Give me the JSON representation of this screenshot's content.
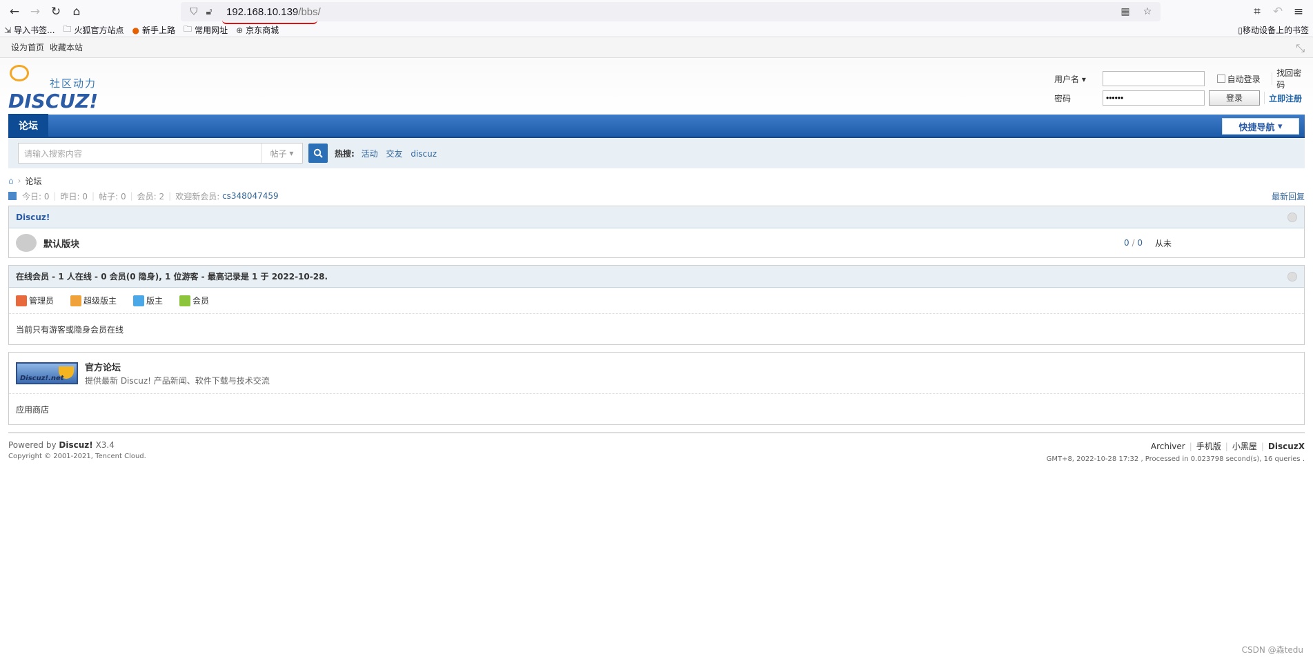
{
  "browser": {
    "url_host": "192.168.10.139",
    "url_path": "/bbs/",
    "bookmarks": [
      {
        "icon": "import-icon",
        "label": "导入书签..."
      },
      {
        "icon": "folder-icon",
        "label": "火狐官方站点"
      },
      {
        "icon": "firefox-icon",
        "label": "新手上路"
      },
      {
        "icon": "folder-icon",
        "label": "常用网址"
      },
      {
        "icon": "globe-icon",
        "label": "京东商城"
      }
    ],
    "mobile_bookmarks": "移动设备上的书签"
  },
  "topbar": {
    "set_home": "设为首页",
    "favorite": "收藏本站"
  },
  "header": {
    "logo_tagline": "社区动力",
    "logo_word": "DISCUZ!",
    "login": {
      "username_label": "用户名",
      "password_label": "密码",
      "password_value": "••••••",
      "auto_login": "自动登录",
      "login_button": "登录",
      "forgot": "找回密码",
      "register": "立即注册"
    }
  },
  "nav": {
    "current": "论坛",
    "quick_nav": "快捷导航"
  },
  "search": {
    "placeholder": "请输入搜索内容",
    "type": "帖子",
    "hot_label": "热搜:",
    "hot_items": [
      "活动",
      "交友",
      "discuz"
    ]
  },
  "breadcrumb": {
    "current": "论坛"
  },
  "stats": {
    "today": "今日: 0",
    "yesterday": "昨日: 0",
    "posts": "帖子: 0",
    "members": "会员: 2",
    "welcome": "欢迎新会员:",
    "new_member": "cs348047459",
    "latest": "最新回复"
  },
  "category": {
    "title": "Discuz!",
    "forum_name": "默认版块",
    "counts_a": "0",
    "counts_b": "0",
    "last_post": "从未"
  },
  "online": {
    "title": "在线会员 - 1 人在线 - 0 会员(0 隐身), 1 位游客 - 最高记录是 1 于 2022-10-28.",
    "legend": [
      {
        "label": "管理员",
        "color": "#e8693b"
      },
      {
        "label": "超级版主",
        "color": "#f0a23a"
      },
      {
        "label": "版主",
        "color": "#4aa8e8"
      },
      {
        "label": "会员",
        "color": "#8cc43c"
      }
    ],
    "text": "当前只有游客或隐身会员在线"
  },
  "links": {
    "name": "官方论坛",
    "desc": "提供最新 Discuz! 产品新闻、软件下载与技术交流",
    "logo_text": "Discuz!.net",
    "appstore": "应用商店"
  },
  "footer": {
    "powered_prefix": "Powered by",
    "powered_name": "Discuz!",
    "version": "X3.4",
    "copyright": "Copyright © 2001-2021, Tencent Cloud.",
    "links": [
      "Archiver",
      "手机版",
      "小黑屋",
      "DiscuzX"
    ],
    "process": "GMT+8, 2022-10-28 17:32 , Processed in 0.023798 second(s), 16 queries ."
  },
  "watermark": "CSDN @森tedu"
}
